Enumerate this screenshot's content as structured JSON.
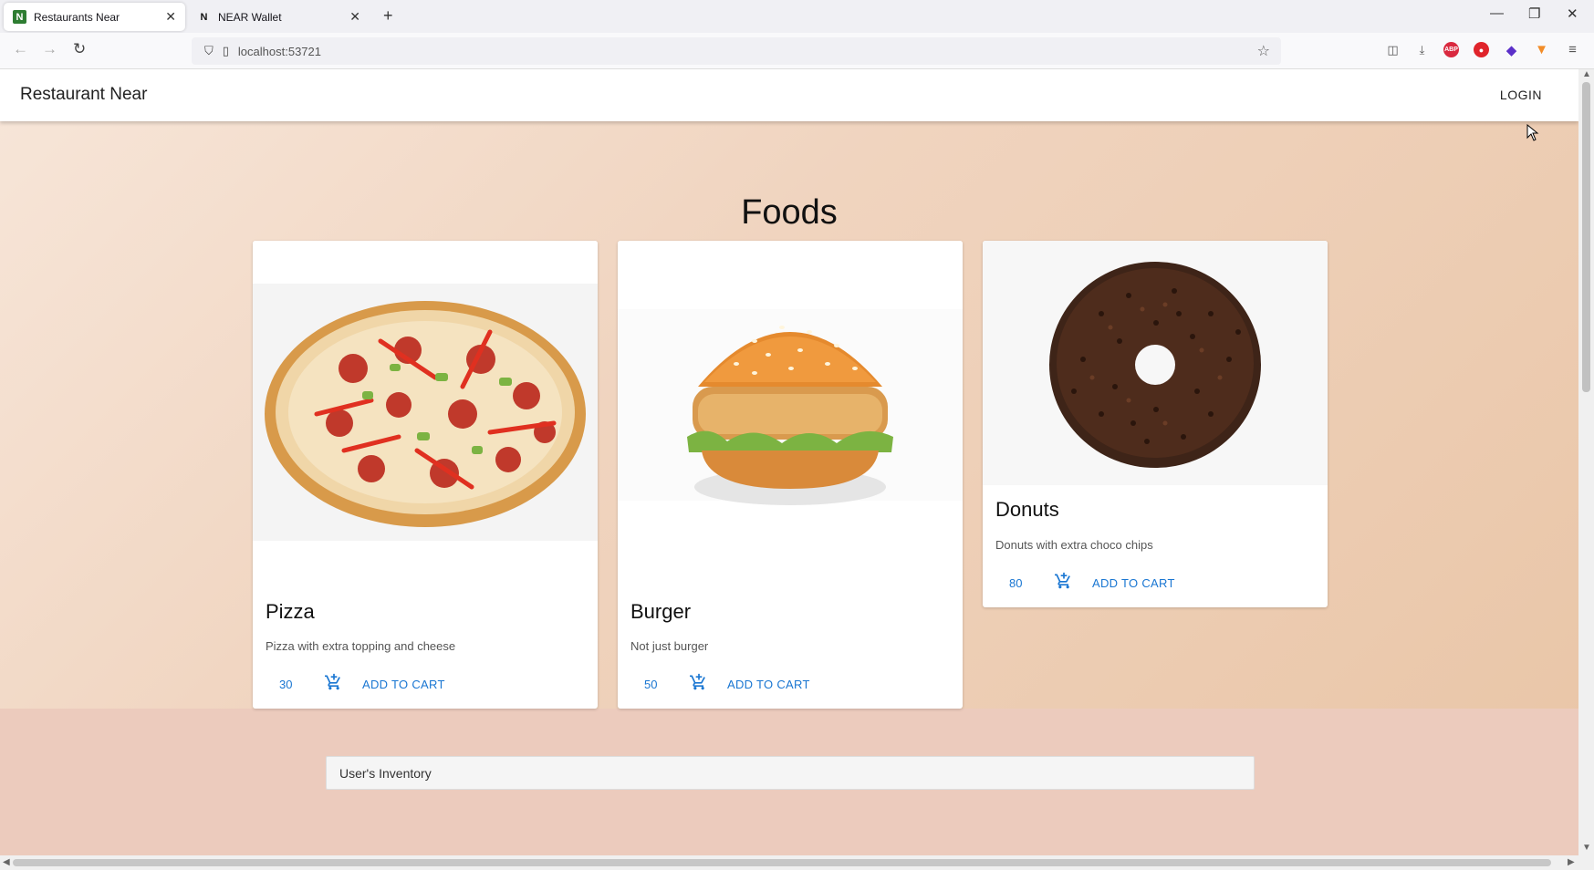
{
  "browser": {
    "tabs": [
      {
        "title": "Restaurants Near",
        "favicon": "N",
        "active": true
      },
      {
        "title": "NEAR Wallet",
        "favicon": "N",
        "active": false
      }
    ],
    "new_tab_symbol": "+",
    "url": "localhost:53721"
  },
  "app": {
    "title": "Restaurant Near",
    "login_label": "LOGIN",
    "section_title": "Foods",
    "foods": [
      {
        "name": "Pizza",
        "description": "Pizza with extra topping and cheese",
        "price": "30",
        "cta": "ADD TO CART"
      },
      {
        "name": "Burger",
        "description": "Not just burger",
        "price": "50",
        "cta": "ADD TO CART"
      },
      {
        "name": "Donuts",
        "description": "Donuts with extra choco chips",
        "price": "80",
        "cta": "ADD TO CART"
      }
    ],
    "inventory_label": "User's Inventory"
  },
  "colors": {
    "accent": "#1976d2",
    "page_gradient_start": "#f7e6d9",
    "page_gradient_end": "#e9c5a6"
  }
}
